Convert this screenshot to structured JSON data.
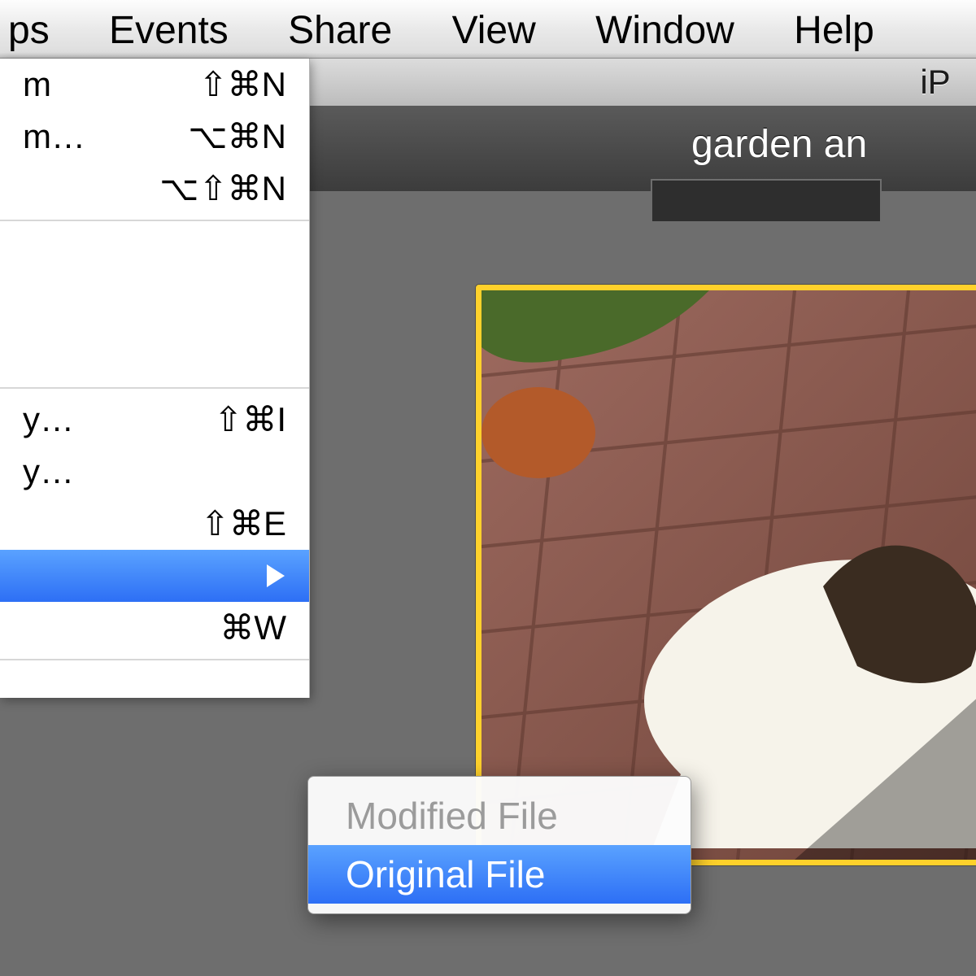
{
  "menubar": {
    "items": [
      "ps",
      "Events",
      "Share",
      "View",
      "Window",
      "Help"
    ]
  },
  "window": {
    "title_fragment": "iP"
  },
  "album": {
    "title_fragment": "garden an"
  },
  "menu": {
    "items": [
      {
        "label_suffix": "m",
        "shortcut": "⇧⌘N"
      },
      {
        "label_suffix": "m…",
        "shortcut": "⌥⌘N"
      },
      {
        "label_suffix": "",
        "shortcut": "⌥⇧⌘N"
      }
    ],
    "items2": [
      {
        "label_suffix": "y…",
        "shortcut": "⇧⌘I"
      },
      {
        "label_suffix": "y…",
        "shortcut": ""
      },
      {
        "label_suffix": "",
        "shortcut": "⇧⌘E"
      }
    ],
    "highlight_label": "",
    "close_shortcut": "⌘W"
  },
  "submenu": {
    "modified": "Modified File",
    "original": "Original File"
  }
}
